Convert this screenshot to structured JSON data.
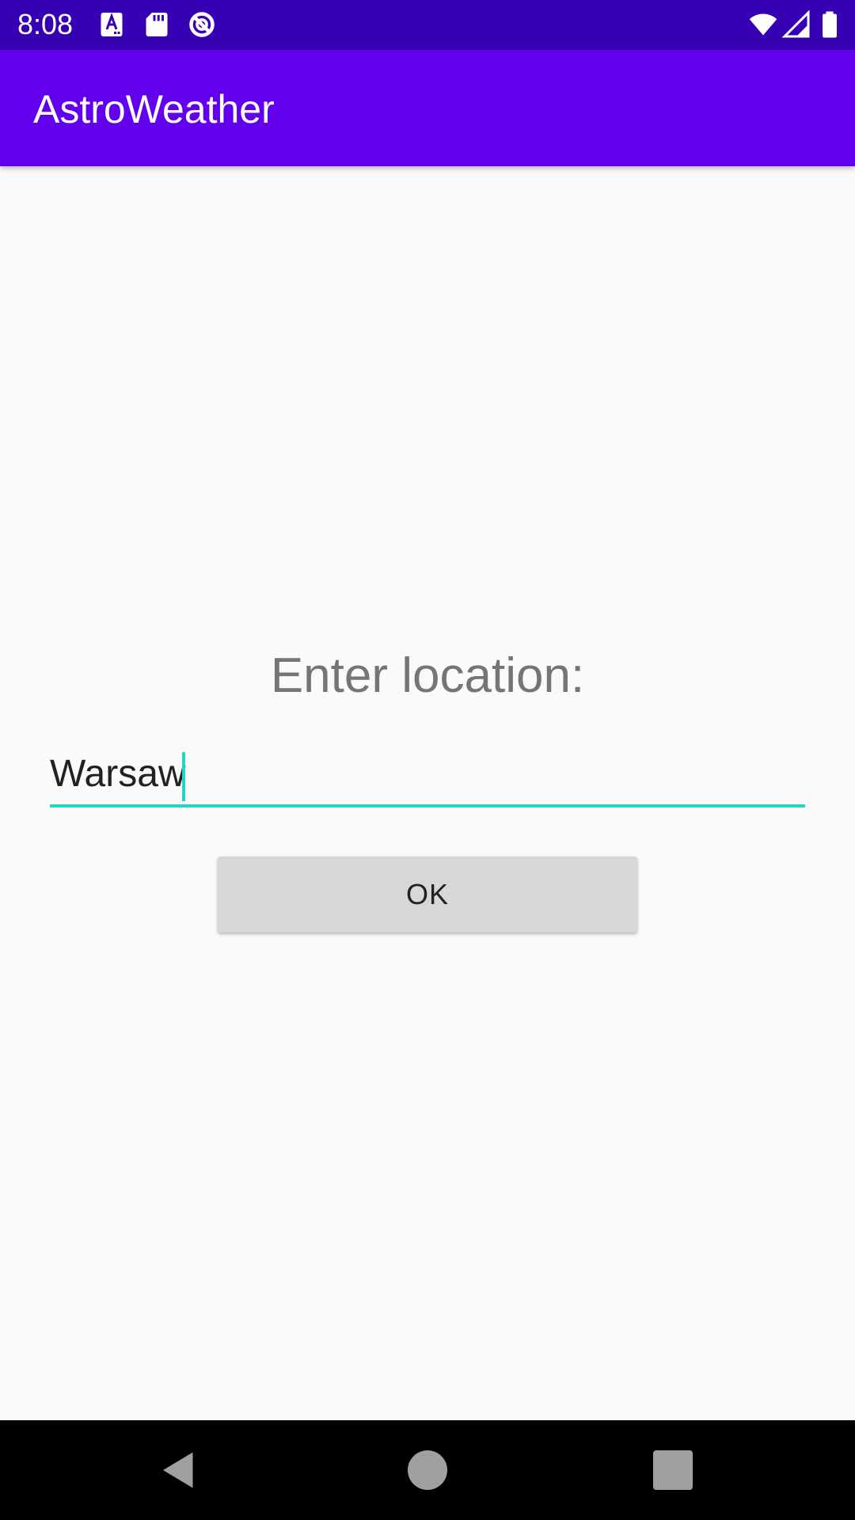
{
  "status_bar": {
    "time": "8:08",
    "background": "#3700b3",
    "left_icons": [
      "text-a-icon",
      "sd-card-icon",
      "blocked-circle-icon"
    ],
    "right_icons": [
      "wifi-icon",
      "cell-signal-icon",
      "battery-icon"
    ]
  },
  "app_bar": {
    "title": "AstroWeather",
    "background": "#6200ee"
  },
  "main": {
    "prompt_label": "Enter location:",
    "location_input": {
      "value": "Warsaw",
      "placeholder": ""
    },
    "ok_button_label": "OK",
    "accent_color": "#26d4c4"
  },
  "nav_bar": {
    "buttons": [
      "back-icon",
      "home-icon",
      "recents-icon"
    ]
  }
}
